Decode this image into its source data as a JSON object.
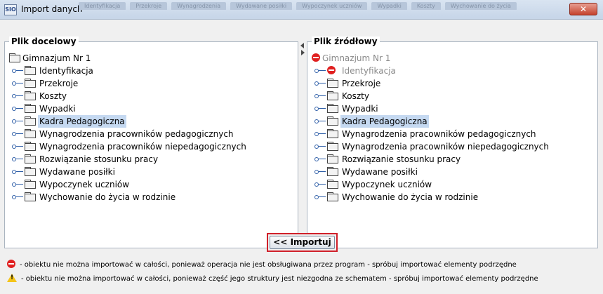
{
  "window": {
    "app_icon_text": "SIO",
    "title": "Import danych",
    "close_label": "✕",
    "background_tabs": [
      "Identyfikacja",
      "Przekroje",
      "Wynagrodzenia",
      "Wydawane posiłki",
      "Wypoczynek uczniów",
      "Wypadki",
      "Koszty",
      "Wychowanie do życia"
    ]
  },
  "left_panel": {
    "legend": "Plik docelowy",
    "root": {
      "label": "Gimnazjum Nr 1",
      "icon": "folder-icon"
    },
    "items": [
      {
        "label": "Identyfikacja",
        "icon": "folder-icon",
        "selected": false
      },
      {
        "label": "Przekroje",
        "icon": "folder-icon",
        "selected": false
      },
      {
        "label": "Koszty",
        "icon": "folder-icon",
        "selected": false
      },
      {
        "label": "Wypadki",
        "icon": "folder-icon",
        "selected": false
      },
      {
        "label": "Kadra Pedagogiczna",
        "icon": "folder-icon",
        "selected": true
      },
      {
        "label": "Wynagrodzenia pracowników pedagogicznych",
        "icon": "folder-icon",
        "selected": false
      },
      {
        "label": "Wynagrodzenia pracowników niepedagogicznych",
        "icon": "folder-icon",
        "selected": false
      },
      {
        "label": "Rozwiązanie stosunku pracy",
        "icon": "folder-icon",
        "selected": false
      },
      {
        "label": "Wydawane posiłki",
        "icon": "folder-icon",
        "selected": false
      },
      {
        "label": "Wypoczynek uczniów",
        "icon": "folder-icon",
        "selected": false
      },
      {
        "label": "Wychowanie do życia w rodzinie",
        "icon": "folder-icon",
        "selected": false
      }
    ]
  },
  "right_panel": {
    "legend": "Plik źródłowy",
    "root": {
      "label": "Gimnazjum Nr 1",
      "icon": "stop-icon",
      "disabled": true
    },
    "items": [
      {
        "label": "Identyfikacja",
        "icon": "stop-icon",
        "disabled": true,
        "selected": false
      },
      {
        "label": "Przekroje",
        "icon": "folder-icon",
        "selected": false
      },
      {
        "label": "Koszty",
        "icon": "folder-icon",
        "selected": false
      },
      {
        "label": "Wypadki",
        "icon": "folder-icon",
        "selected": false
      },
      {
        "label": "Kadra Pedagogiczna",
        "icon": "folder-icon",
        "selected": true
      },
      {
        "label": "Wynagrodzenia pracowników pedagogicznych",
        "icon": "folder-icon",
        "selected": false
      },
      {
        "label": "Wynagrodzenia pracowników niepedagogicznych",
        "icon": "folder-icon",
        "selected": false
      },
      {
        "label": "Rozwiązanie stosunku pracy",
        "icon": "folder-icon",
        "selected": false
      },
      {
        "label": "Wydawane posiłki",
        "icon": "folder-icon",
        "selected": false
      },
      {
        "label": "Wypoczynek uczniów",
        "icon": "folder-icon",
        "selected": false
      },
      {
        "label": "Wychowanie do życia w rodzinie",
        "icon": "folder-icon",
        "selected": false
      }
    ]
  },
  "import_button": {
    "label": "<< Importuj"
  },
  "legend": {
    "error_text": "- obiektu nie można importować w całości, ponieważ operacja nie jest obsługiwana przez program - spróbuj importować elementy podrzędne",
    "warning_text": "- obiektu nie można importować w całości, ponieważ część jego struktury jest niezgodna ze schematem - spróbuj importować elementy podrzędne"
  },
  "colors": {
    "highlight_border": "#d0202a",
    "selection": "#c5d9f1",
    "tree_line": "#2f5fa8",
    "error_icon": "#e02020",
    "warning_icon": "#f4c419"
  }
}
